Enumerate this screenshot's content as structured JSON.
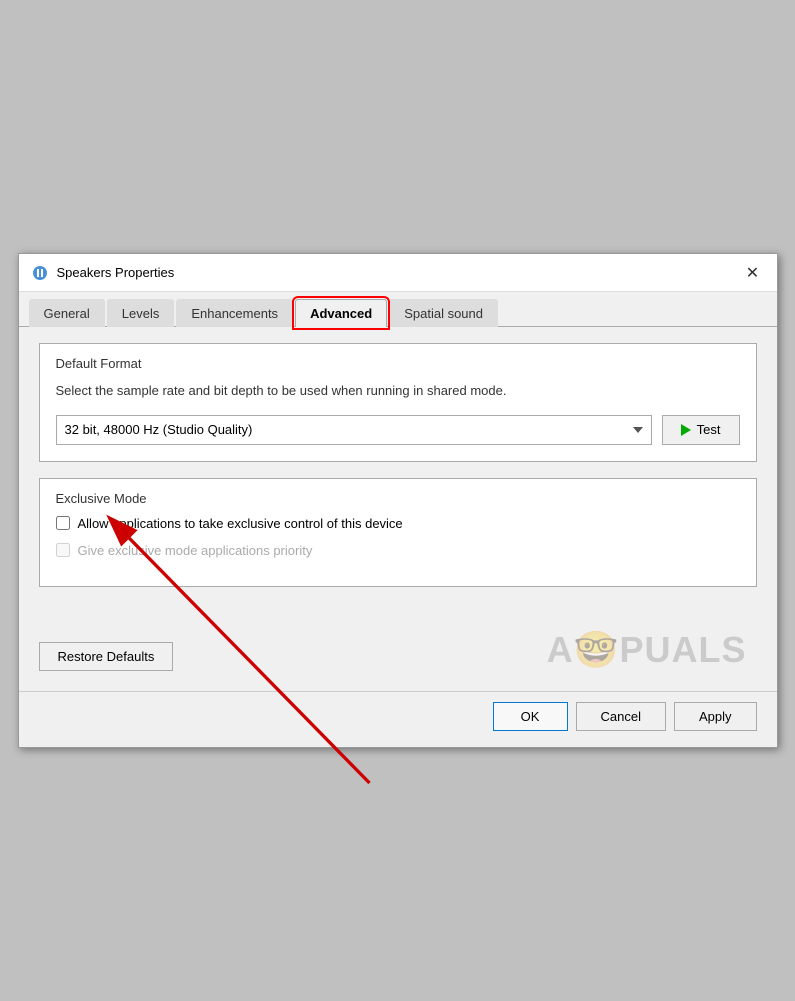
{
  "window": {
    "title": "Speakers Properties",
    "close_label": "✕"
  },
  "tabs": [
    {
      "id": "general",
      "label": "General",
      "active": false,
      "highlighted": false
    },
    {
      "id": "levels",
      "label": "Levels",
      "active": false,
      "highlighted": false
    },
    {
      "id": "enhancements",
      "label": "Enhancements",
      "active": false,
      "highlighted": false
    },
    {
      "id": "advanced",
      "label": "Advanced",
      "active": true,
      "highlighted": true
    },
    {
      "id": "spatial-sound",
      "label": "Spatial sound",
      "active": false,
      "highlighted": false
    }
  ],
  "sections": {
    "default_format": {
      "label": "Default Format",
      "description": "Select the sample rate and bit depth to be used when running in shared mode.",
      "select_value": "32 bit, 48000 Hz (Studio Quality)",
      "test_button_label": "Test"
    },
    "exclusive_mode": {
      "label": "Exclusive Mode",
      "checkbox1_label": "Allow applications to take exclusive control of this device",
      "checkbox1_checked": false,
      "checkbox2_label": "Give exclusive mode applications priority",
      "checkbox2_checked": false,
      "checkbox2_disabled": true
    }
  },
  "buttons": {
    "restore_defaults": "Restore Defaults",
    "ok": "OK",
    "cancel": "Cancel",
    "apply": "Apply"
  },
  "colors": {
    "active_tab_outline": "#cc0000",
    "play_icon": "#00aa00"
  }
}
